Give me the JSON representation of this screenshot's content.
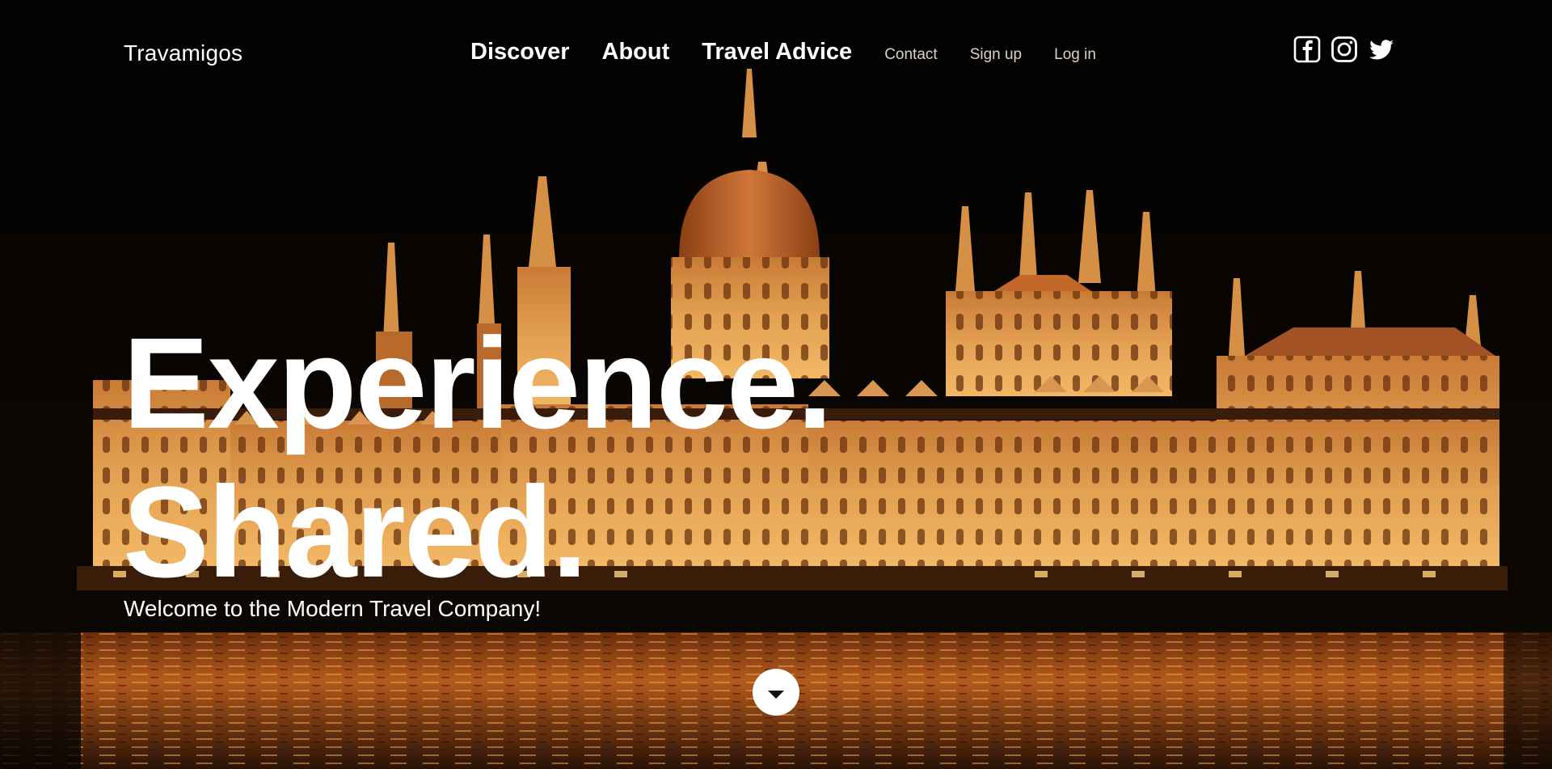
{
  "brand": {
    "name": "Travamigos"
  },
  "nav": {
    "primary": [
      {
        "label": "Discover"
      },
      {
        "label": "About"
      },
      {
        "label": "Travel Advice"
      }
    ],
    "secondary": [
      {
        "label": "Contact"
      },
      {
        "label": "Sign up"
      },
      {
        "label": "Log in"
      }
    ]
  },
  "social": {
    "icons": [
      "facebook-icon",
      "instagram-icon",
      "twitter-icon"
    ]
  },
  "hero": {
    "headline_line1": "Experience.",
    "headline_line2": "Shared.",
    "tagline": "Welcome to the Modern Travel Company!",
    "scroll_icon": "chevron-down-icon"
  },
  "colors": {
    "sky": "#050302",
    "building_glow": "#e8a04a",
    "building_dark": "#7a3d10",
    "water": "#b0551a",
    "text": "#ffffff",
    "nav_minor": "#d7d2cc"
  }
}
